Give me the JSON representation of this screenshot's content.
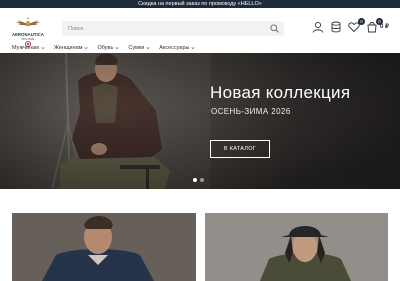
{
  "promo": {
    "text": "Скидка на первый заказ по промокоду «HELLO»"
  },
  "logo": {
    "brand": "AERONAUTICA",
    "sub": "MILITARE"
  },
  "search": {
    "placeholder": "Поиск"
  },
  "header_icons": [
    {
      "name": "account-icon"
    },
    {
      "name": "database-icon"
    },
    {
      "name": "heart-icon",
      "badge": "0"
    },
    {
      "name": "cart-icon",
      "badge": "0"
    }
  ],
  "cart": {
    "total": "0 ₽"
  },
  "nav": {
    "items": [
      {
        "label": "Мужчинам"
      },
      {
        "label": "Женщинам"
      },
      {
        "label": "Обувь"
      },
      {
        "label": "Сумки"
      },
      {
        "label": "Аксессуары"
      }
    ]
  },
  "hero": {
    "title": "Новая коллекция",
    "subtitle": "ОСЕНЬ-ЗИМА 2026",
    "button_label": "В КАТАЛОГ",
    "slides_count": 2,
    "active_slide": 1
  },
  "colors": {
    "promo_bg": "#1d2b3a",
    "accent": "#1d2b3a",
    "hero_text": "#ffffff"
  }
}
